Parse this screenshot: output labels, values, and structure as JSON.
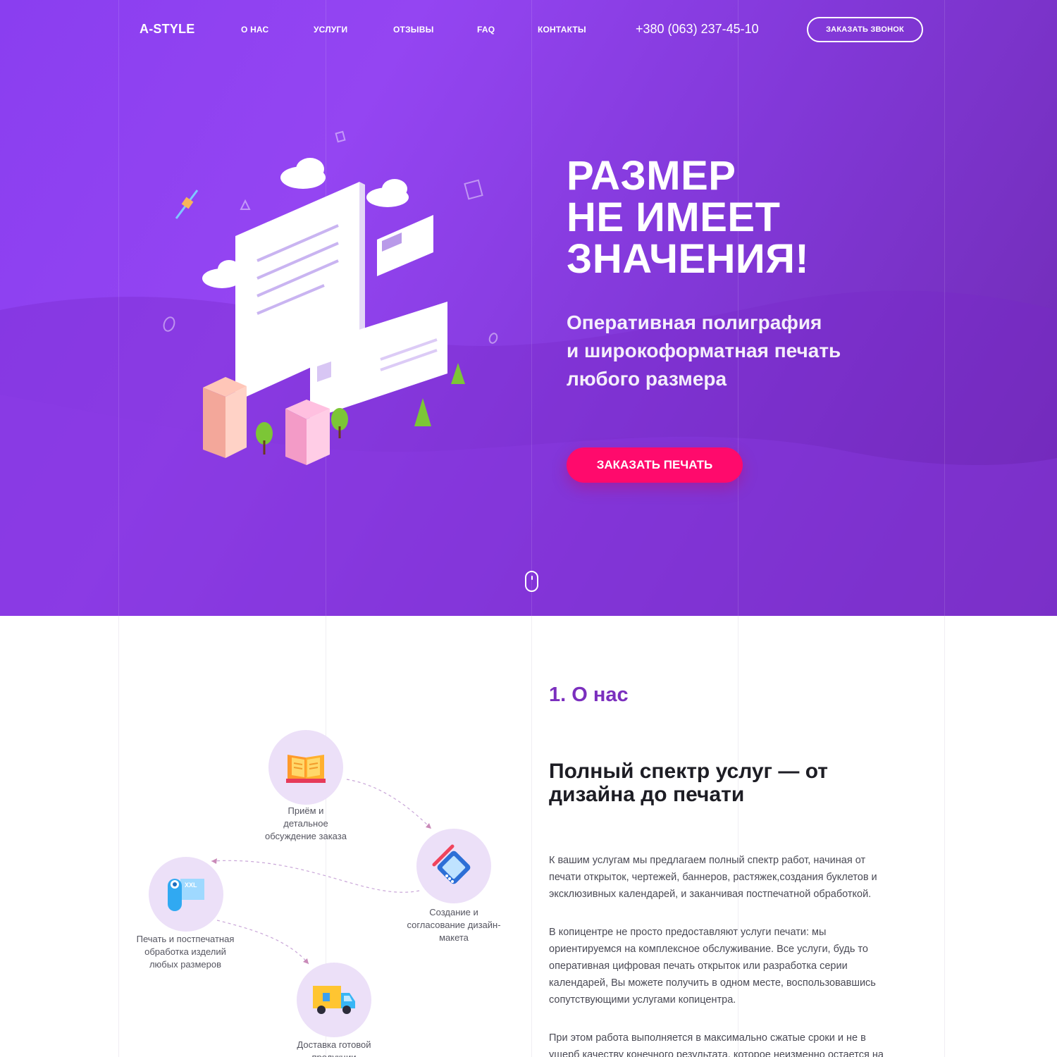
{
  "header": {
    "logo": "A-STYLE",
    "nav": [
      {
        "label": "О НАС"
      },
      {
        "label": "УСЛУГИ"
      },
      {
        "label": "ОТЗЫВЫ"
      },
      {
        "label": "FAQ"
      },
      {
        "label": "КОНТАКТЫ"
      }
    ],
    "phone": "+380 (063) 237-45-10",
    "callback_label": "ЗАКАЗАТЬ ЗВОНОК"
  },
  "hero": {
    "title_lines": [
      "РАЗМЕР",
      "НЕ ИМЕЕТ",
      "ЗНАЧЕНИЯ!"
    ],
    "subtitle_lines": [
      "Оперативная полиграфия",
      "и широкоформатная печать",
      "любого размера"
    ],
    "order_label": "ЗАКАЗАТЬ ПЕЧАТЬ",
    "accent_color": "#ff0a6c",
    "bg_color": "#8a3ef0"
  },
  "about": {
    "section_number": "1. О нас",
    "heading_lines": [
      "Полный спектр услуг — от",
      "дизайна до печати"
    ],
    "paragraphs": [
      [
        "К вашим услугам мы предлагаем полный спектр работ, начиная от",
        "печати открыток, чертежей, баннеров, растяжек,создания буклетов и",
        "эксклюзивных календарей, и заканчивая постпечатной обработкой."
      ],
      [
        "В копицентре не просто предоставляют услуги печати: мы",
        "ориентируемся на комплексное обслуживание. Все услуги, будь то",
        "оперативная цифровая печать открыток или разработка серии",
        "календарей, Вы можете получить в одном месте, воспользовавшись",
        "сопутствующими услугами копицентра."
      ],
      [
        "При этом работа выполняется в максимально сжатые сроки и не в",
        "ущерб качеству конечного результата, которое неизменно остается на"
      ]
    ],
    "steps": [
      {
        "icon": "book-icon",
        "lines": [
          "Приём и",
          "детальное",
          "обсуждение заказа"
        ]
      },
      {
        "icon": "design-tablet-icon",
        "lines": [
          "Создание и",
          "согласование дизайн-",
          "макета"
        ]
      },
      {
        "icon": "print-roll-icon",
        "lines": [
          "Печать и постпечатная",
          "обработка изделий",
          "любых размеров"
        ]
      },
      {
        "icon": "delivery-truck-icon",
        "lines": [
          "Доставка готовой",
          "продукции"
        ]
      }
    ],
    "title_color": "#7b2fbe"
  }
}
